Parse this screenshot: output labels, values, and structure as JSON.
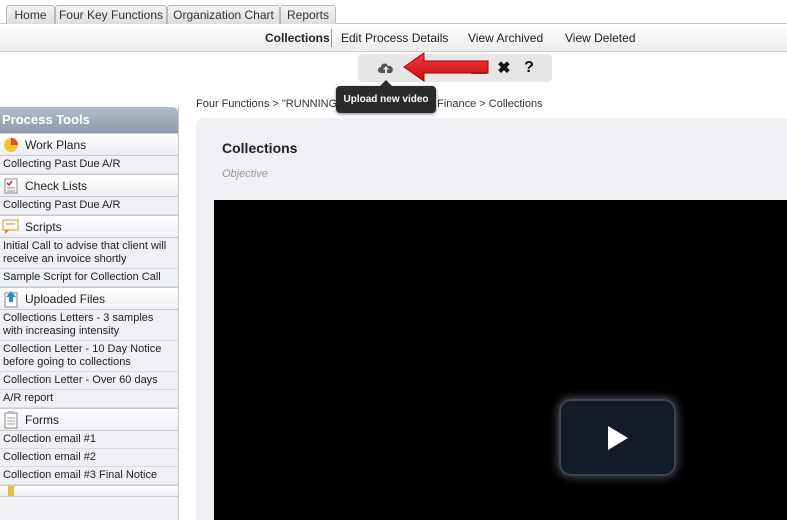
{
  "tabs": [
    "Home",
    "Four Key Functions",
    "Organization Chart",
    "Reports"
  ],
  "subnav": {
    "active": "Collections",
    "items": [
      "Edit Process Details",
      "View Archived",
      "View Deleted"
    ]
  },
  "toolbar": {
    "upload_icon": "cloud-upload-icon",
    "close_label": "✖",
    "help_label": "?",
    "tooltip": "Upload new video"
  },
  "breadcrumb": "Four Functions > \"RUNNING\" THE BUSINESS > Finance > Collections",
  "sidebar": {
    "title": "Process Tools",
    "sections": [
      {
        "label": "Work Plans",
        "icon": "pie-chart-icon",
        "items": [
          "Collecting Past Due A/R"
        ]
      },
      {
        "label": "Check Lists",
        "icon": "checklist-icon",
        "items": [
          "Collecting Past Due A/R"
        ]
      },
      {
        "label": "Scripts",
        "icon": "script-icon",
        "items": [
          "Initial Call to advise that client will receive an invoice shortly",
          "Sample Script for Collection Call"
        ]
      },
      {
        "label": "Uploaded Files",
        "icon": "upload-file-icon",
        "items": [
          "Collections Letters - 3 samples with increasing intensity",
          "Collection Letter - 10 Day Notice before going to collections",
          "Collection Letter - Over 60 days",
          "A/R report"
        ]
      },
      {
        "label": "Forms",
        "icon": "form-icon",
        "items": [
          "Collection email #1",
          "Collection email #2",
          "Collection email #3 Final Notice"
        ]
      }
    ]
  },
  "main": {
    "title": "Collections",
    "objective": "Objective"
  },
  "colors": {
    "annotation_arrow": "#e8202a",
    "video_bg": "#000000",
    "sidebar_header": "#9aa5b4"
  }
}
